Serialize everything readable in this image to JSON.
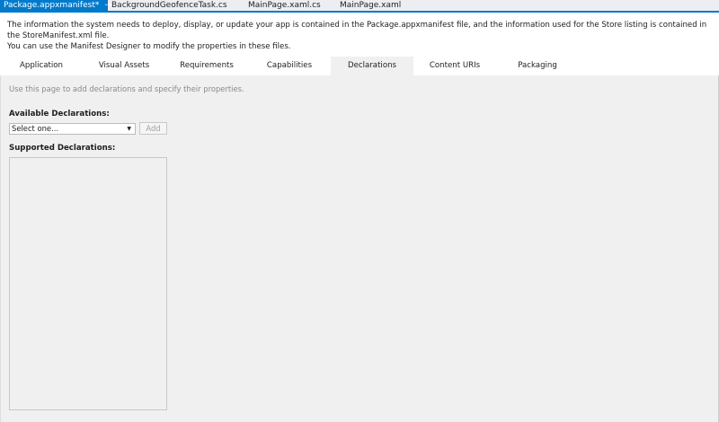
{
  "doc_tabs": [
    {
      "label": "Package.appxmanifest*",
      "active": true
    },
    {
      "label": "BackgroundGeofenceTask.cs"
    },
    {
      "label": "MainPage.xaml.cs"
    },
    {
      "label": "MainPage.xaml"
    }
  ],
  "icons": {
    "pin": "⊸",
    "close": "✕",
    "dropdown": "▼"
  },
  "intro": [
    "The information the system needs to deploy, display, or update your app is contained in the Package.appxmanifest file, and the information used for the Store listing is contained in the StoreManifest.xml file.",
    "You can use the Manifest Designer to modify the properties in these files."
  ],
  "tabs": [
    "Application",
    "Visual Assets",
    "Requirements",
    "Capabilities",
    "Declarations",
    "Content URIs",
    "Packaging"
  ],
  "selected_tab": "Declarations",
  "hint": "Use this page to add declarations and specify their properties.",
  "available_label": "Available Declarations:",
  "select_value": "Select one...",
  "add_label": "Add",
  "supported_label": "Supported Declarations:",
  "colors": {
    "accent": "#007acc",
    "page_bg": "#f0f0f0"
  }
}
